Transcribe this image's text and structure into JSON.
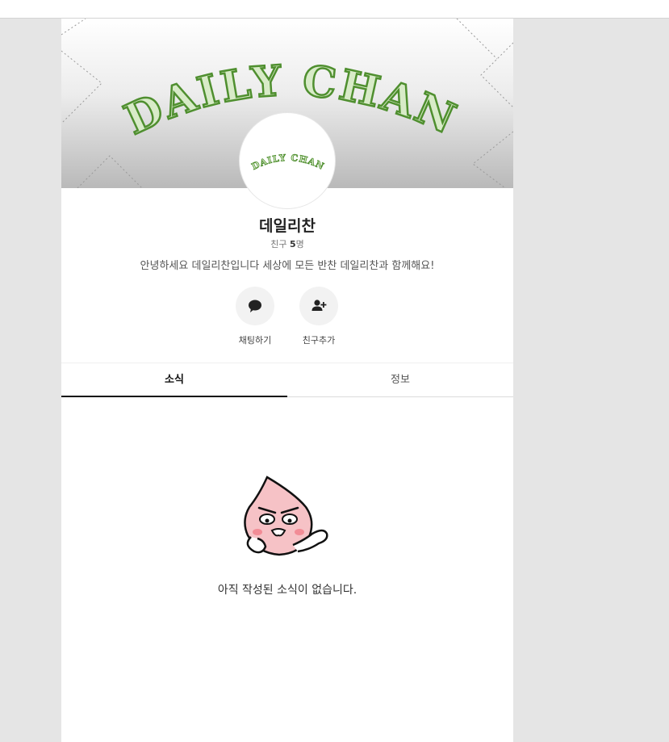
{
  "profile": {
    "cover_text": "DAILY CHAN",
    "avatar_text": "DAILY CHAN",
    "name": "데일리찬",
    "friends_prefix": "친구 ",
    "friends_count": "5",
    "friends_suffix": "명",
    "description": "안녕하세요 데일리찬입니다 세상에 모든 반찬 데일리찬과 함께해요!"
  },
  "actions": [
    {
      "label": "채팅하기",
      "icon": "chat-bubble-icon"
    },
    {
      "label": "친구추가",
      "icon": "add-friend-icon"
    }
  ],
  "tabs": [
    {
      "label": "소식",
      "active": true
    },
    {
      "label": "정보",
      "active": false
    }
  ],
  "empty_state": {
    "message": "아직 작성된 소식이 없습니다.",
    "illustration": "peach-character-icon"
  },
  "colors": {
    "brand_green": "#5a9a3a",
    "background": "#e5e5e5",
    "tab_active": "#111111"
  }
}
